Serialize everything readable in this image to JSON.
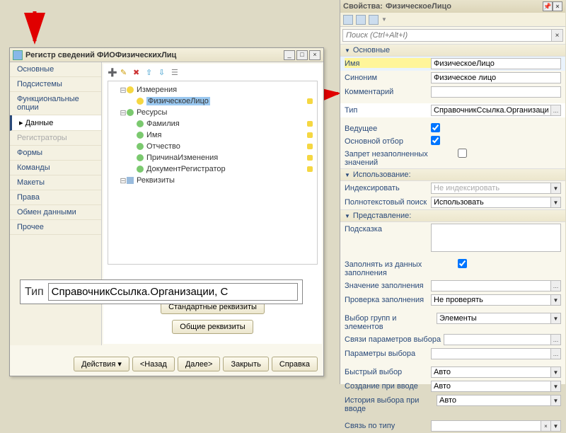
{
  "win": {
    "title": "Регистр сведений ФИОФизическихЛиц",
    "sidebar": [
      "Основные",
      "Подсистемы",
      "Функциональные опции",
      "Данные",
      "Регистраторы",
      "Формы",
      "Команды",
      "Макеты",
      "Права",
      "Обмен данными",
      "Прочее"
    ],
    "tree": {
      "n1": "Измерения",
      "n1_1": "ФизическоеЛицо",
      "n2": "Ресурсы",
      "n2_1": "Фамилия",
      "n2_2": "Имя",
      "n2_3": "Отчество",
      "n2_4": "ПричинаИзменения",
      "n2_5": "ДокументРегистратор",
      "n3": "Реквизиты"
    },
    "btn_std": "Стандартные реквизиты",
    "btn_common": "Общие реквизиты",
    "footer": {
      "act": "Действия",
      "back": "<Назад",
      "next": "Далее>",
      "close": "Закрыть",
      "help": "Справка"
    }
  },
  "zoom": {
    "lbl": "Тип",
    "val": "СправочникСсылка.Организации, С"
  },
  "panel": {
    "title1": "Свойства:",
    "title2": "ФизическоеЛицо",
    "search_ph": "Поиск (Ctrl+Alt+I)",
    "sections": {
      "s1": "Основные",
      "s2": "Использование:",
      "s3": "Представление:"
    },
    "rows": {
      "name_l": "Имя",
      "name_v": "ФизическоеЛицо",
      "syn_l": "Синоним",
      "syn_v": "Физическое лицо",
      "comm_l": "Комментарий",
      "comm_v": "",
      "tip_l": "Тип",
      "tip_v": "СправочникСсылка.Организации, СправочникСсылка.Физические",
      "ved_l": "Ведущее",
      "osn_l": "Основной отбор",
      "zap_l": "Запрет незаполненных значений",
      "idx_l": "Индексировать",
      "idx_v": "Не индексировать",
      "ftx_l": "Полнотекстовый поиск",
      "ftx_v": "Использовать",
      "hint_l": "Подсказка",
      "fill_l": "Заполнять из данных заполнения",
      "zval_l": "Значение заполнения",
      "chk_l": "Проверка заполнения",
      "chk_v": "Не проверять",
      "grp_l": "Выбор групп и элементов",
      "grp_v": "Элементы",
      "lnk_l": "Связи параметров выбора",
      "par_l": "Параметры выбора",
      "fast_l": "Быстрый выбор",
      "fast_v": "Авто",
      "crt_l": "Создание при вводе",
      "crt_v": "Авто",
      "hist_l": "История выбора при вводе",
      "hist_v": "Авто",
      "rel_l": "Связь по типу"
    }
  }
}
